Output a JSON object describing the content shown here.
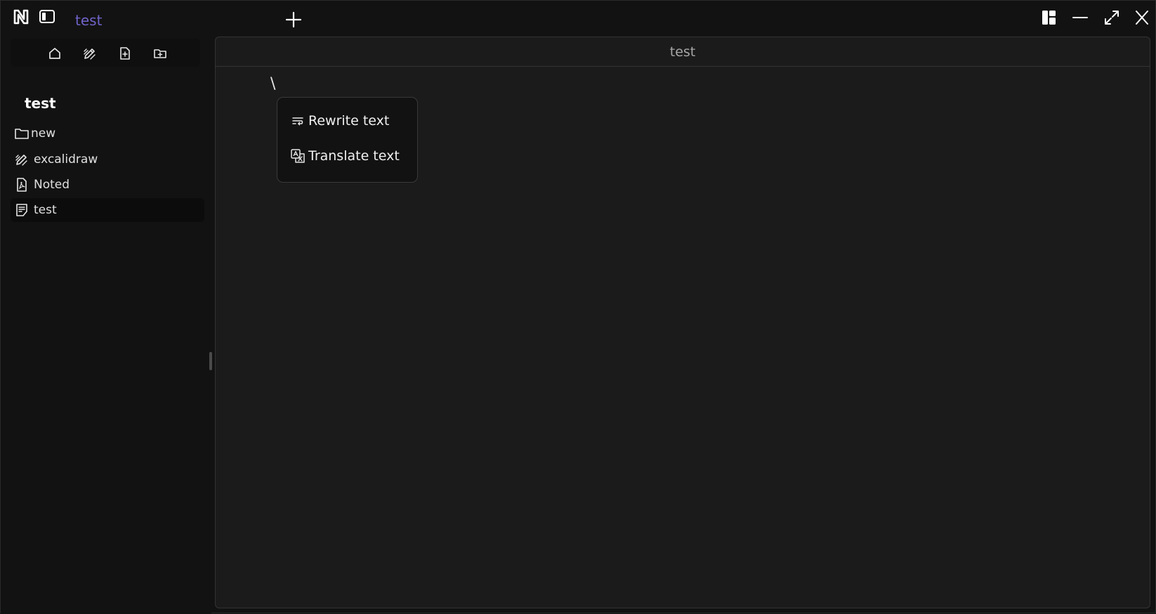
{
  "titlebar": {
    "tab_title": "test"
  },
  "sidebar": {
    "workspace_title": "test",
    "items": [
      {
        "label": "new",
        "icon": "folder-icon"
      },
      {
        "label": "excalidraw",
        "icon": "draw-icon"
      },
      {
        "label": "Noted",
        "icon": "pdf-file-icon"
      },
      {
        "label": "test",
        "icon": "note-file-icon",
        "active": true
      }
    ]
  },
  "editor": {
    "header_title": "test",
    "content": "\\"
  },
  "popup": {
    "items": [
      {
        "label": "Rewrite text",
        "icon": "wrap-text-icon"
      },
      {
        "label": "Translate text",
        "icon": "translate-icon"
      }
    ]
  },
  "colors": {
    "accent": "#6f63c9",
    "background": "#121212",
    "editor_background": "#1b1b1b"
  }
}
